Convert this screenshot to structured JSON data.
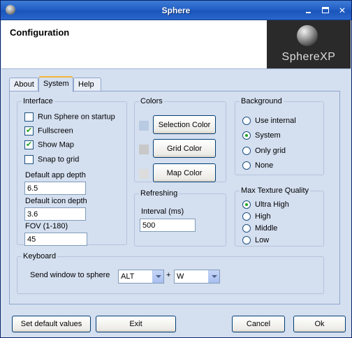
{
  "window": {
    "title": "Sphere"
  },
  "header": {
    "title": "Configuration",
    "logo_text": "SphereXP"
  },
  "tabs": [
    {
      "label": "About"
    },
    {
      "label": "System"
    },
    {
      "label": "Help"
    }
  ],
  "active_tab": "System",
  "interface": {
    "legend": "Interface",
    "checkboxes": [
      {
        "label": "Run Sphere on startup",
        "checked": false
      },
      {
        "label": "Fullscreen",
        "checked": true
      },
      {
        "label": "Show Map",
        "checked": true
      },
      {
        "label": "Snap to grid",
        "checked": false
      }
    ],
    "app_depth_label": "Default app depth",
    "app_depth_value": "6.5",
    "icon_depth_label": "Default icon depth",
    "icon_depth_value": "3.6",
    "fov_label": "FOV (1-180)",
    "fov_value": "45"
  },
  "colors": {
    "legend": "Colors",
    "selection_label": "Selection Color",
    "grid_label": "Grid Color",
    "map_label": "Map Color",
    "selection_swatch": "#b9cbe2",
    "grid_swatch": "#c8c8c8",
    "map_swatch": "#dcdcdc"
  },
  "refreshing": {
    "legend": "Refreshing",
    "interval_label": "Interval (ms)",
    "interval_value": "500"
  },
  "background": {
    "legend": "Background",
    "options": [
      {
        "label": "Use internal",
        "checked": false
      },
      {
        "label": "System",
        "checked": true
      },
      {
        "label": "Only grid",
        "checked": false
      },
      {
        "label": "None",
        "checked": false
      }
    ]
  },
  "texture": {
    "legend": "Max Texture Quality",
    "options": [
      {
        "label": "Ultra High",
        "checked": true
      },
      {
        "label": "High",
        "checked": false
      },
      {
        "label": "Middle",
        "checked": false
      },
      {
        "label": "Low",
        "checked": false
      }
    ]
  },
  "keyboard": {
    "legend": "Keyboard",
    "send_label": "Send window to sphere",
    "modifier_value": "ALT",
    "plus": "+",
    "key_value": "W"
  },
  "buttons": {
    "default": "Set default values",
    "exit": "Exit",
    "cancel": "Cancel",
    "ok": "Ok"
  }
}
